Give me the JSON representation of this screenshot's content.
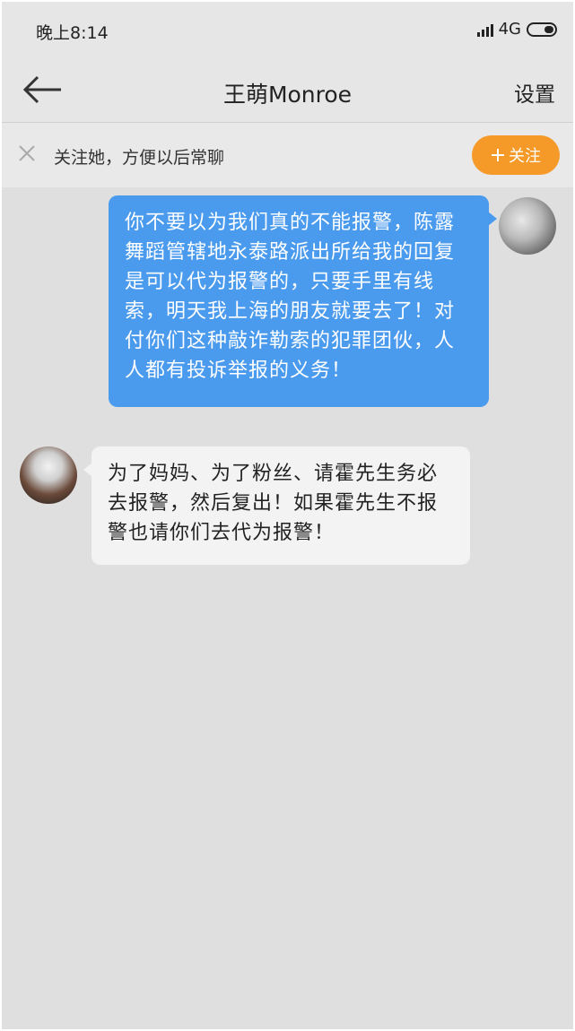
{
  "status_bar": {
    "time": "晚上8:14",
    "network": "4G"
  },
  "header": {
    "title": "王萌Monroe",
    "settings_label": "设置"
  },
  "follow_bar": {
    "prompt": "关注她，方便以后常聊",
    "follow_label": "关注",
    "follow_color": "#f59a29"
  },
  "messages": [
    {
      "direction": "outgoing",
      "text": "你不要以为我们真的不能报警，陈露舞蹈管辖地永泰路派出所给我的回复是可以代为报警的，只要手里有线索，明天我上海的朋友就要去了！对付你们这种敲诈勒索的犯罪团伙，人人都有投诉举报的义务！",
      "bubble_color": "#4a9aee"
    },
    {
      "direction": "incoming",
      "text": "为了妈妈、为了粉丝、请霍先生务必去报警，然后复出！如果霍先生不报警也请你们去代为报警！",
      "bubble_color": "#f3f3f3"
    }
  ]
}
